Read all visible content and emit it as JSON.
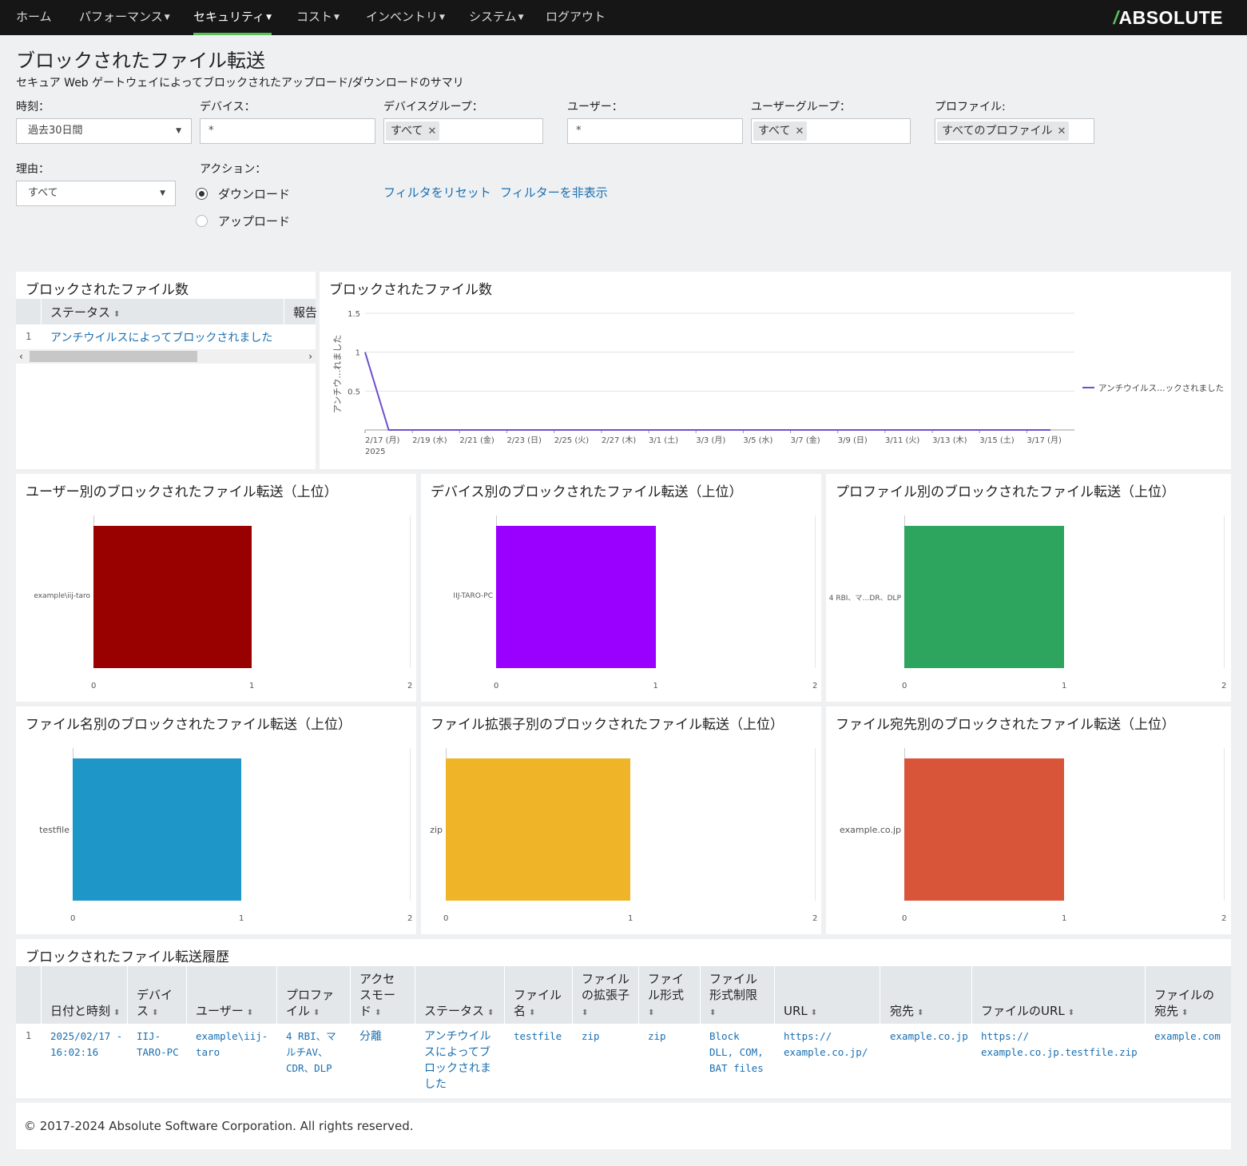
{
  "nav": {
    "home": "ホーム",
    "performance": "パフォーマンス",
    "security": "セキュリティ",
    "cost": "コスト",
    "inventory": "インベントリ",
    "system": "システム",
    "logout": "ログアウト",
    "brand": "ABSOLUTE",
    "brand_mark": "/"
  },
  "page": {
    "title": "ブロックされたファイル転送",
    "subtitle": "セキュア Web ゲートウェイによってブロックされたアップロード/ダウンロードのサマリ"
  },
  "filters": {
    "time_label": "時刻：",
    "time_value": "過去30日間",
    "device_label": "デバイス：",
    "device_value": "*",
    "device_group_label": "デバイスグループ：",
    "device_group_tag": "すべて",
    "user_label": "ユーザー：",
    "user_value": "*",
    "user_group_label": "ユーザーグループ：",
    "user_group_tag": "すべて",
    "profile_label": "プロファイル:",
    "profile_tag": "すべてのプロファイル",
    "reason_label": "理由：",
    "reason_value": "すべて",
    "action_label": "アクション：",
    "action_download": "ダウンロード",
    "action_upload": "アップロード",
    "selected_action": "ダウンロード",
    "reset_link": "フィルタをリセット",
    "hide_link": "フィルターを非表示"
  },
  "count_table": {
    "title": "ブロックされたファイル数",
    "col_status": "ステータス",
    "col_report": "報告",
    "rows": [
      {
        "index": "1",
        "status": "アンチウイルスによってブロックされました"
      }
    ]
  },
  "line_chart": {
    "title": "ブロックされたファイル数",
    "ylabel": "アンチウ…れました",
    "year_label": "2025",
    "line_color": "#6f4fd0"
  },
  "bar_panels": {
    "user": {
      "title": "ユーザー別のブロックされたファイル転送（上位）",
      "color": "#990000"
    },
    "device": {
      "title": "デバイス別のブロックされたファイル転送（上位）",
      "color": "#9900ff"
    },
    "profile": {
      "title": "プロファイル別のブロックされたファイル転送（上位）",
      "color": "#2ea55e"
    },
    "filename": {
      "title": "ファイル名別のブロックされたファイル転送（上位）",
      "color": "#1e96c8"
    },
    "ext": {
      "title": "ファイル拡張子別のブロックされたファイル転送（上位）",
      "color": "#f0b429"
    },
    "dest": {
      "title": "ファイル宛先別のブロックされたファイル転送（上位）",
      "color": "#d9553a"
    }
  },
  "chart_data": [
    {
      "type": "line",
      "title": "ブロックされたファイル数",
      "ylabel": "アンチウ…れました",
      "x": [
        "2/17 (月)",
        "2/18",
        "2/19 (水)",
        "2/20",
        "2/21 (金)",
        "2/22",
        "2/23 (日)",
        "2/24",
        "2/25 (火)",
        "2/26",
        "2/27 (木)",
        "2/28",
        "3/1 (土)",
        "3/2",
        "3/3 (月)",
        "3/4",
        "3/5 (水)",
        "3/6",
        "3/7 (金)",
        "3/8",
        "3/9 (日)",
        "3/10",
        "3/11 (火)",
        "3/12",
        "3/13 (木)",
        "3/14",
        "3/15 (土)",
        "3/16",
        "3/17 (月)",
        "3/18"
      ],
      "x_tick_labels": [
        "2/17 (月)",
        "2/19 (水)",
        "2/21 (金)",
        "2/23 (日)",
        "2/25 (火)",
        "2/27 (木)",
        "3/1 (土)",
        "3/3 (月)",
        "3/5 (水)",
        "3/7 (金)",
        "3/9 (日)",
        "3/11 (火)",
        "3/13 (木)",
        "3/15 (土)",
        "3/17 (月)"
      ],
      "y_tick_labels": [
        "1.5",
        "1",
        "0.5"
      ],
      "ylim": [
        0,
        1.5
      ],
      "legend_position": "right",
      "series": [
        {
          "name": "アンチウイルス…ックされました",
          "values": [
            1,
            0,
            0,
            0,
            0,
            0,
            0,
            0,
            0,
            0,
            0,
            0,
            0,
            0,
            0,
            0,
            0,
            0,
            0,
            0,
            0,
            0,
            0,
            0,
            0,
            0,
            0,
            0,
            0,
            0
          ]
        }
      ],
      "grid": true
    },
    {
      "type": "bar",
      "orientation": "horizontal",
      "title": "ユーザー別のブロックされたファイル転送（上位）",
      "categories": [
        "example\\iij-taro"
      ],
      "values": [
        1
      ],
      "xlim": [
        0,
        2
      ],
      "x_tick_labels": [
        "0",
        "1",
        "2"
      ]
    },
    {
      "type": "bar",
      "orientation": "horizontal",
      "title": "デバイス別のブロックされたファイル転送（上位）",
      "categories": [
        "IIJ-TARO-PC"
      ],
      "values": [
        1
      ],
      "xlim": [
        0,
        2
      ],
      "x_tick_labels": [
        "0",
        "1",
        "2"
      ]
    },
    {
      "type": "bar",
      "orientation": "horizontal",
      "title": "プロファイル別のブロックされたファイル転送（上位）",
      "categories": [
        "4 RBI、マ…DR、DLP"
      ],
      "values": [
        1
      ],
      "xlim": [
        0,
        2
      ],
      "x_tick_labels": [
        "0",
        "1",
        "2"
      ]
    },
    {
      "type": "bar",
      "orientation": "horizontal",
      "title": "ファイル名別のブロックされたファイル転送（上位）",
      "categories": [
        "testfile"
      ],
      "values": [
        1
      ],
      "xlim": [
        0,
        2
      ],
      "x_tick_labels": [
        "0",
        "1",
        "2"
      ]
    },
    {
      "type": "bar",
      "orientation": "horizontal",
      "title": "ファイル拡張子別のブロックされたファイル転送（上位）",
      "categories": [
        "zip"
      ],
      "values": [
        1
      ],
      "xlim": [
        0,
        2
      ],
      "x_tick_labels": [
        "0",
        "1",
        "2"
      ]
    },
    {
      "type": "bar",
      "orientation": "horizontal",
      "title": "ファイル宛先別のブロックされたファイル転送（上位）",
      "categories": [
        "example.co.jp"
      ],
      "values": [
        1
      ],
      "xlim": [
        0,
        2
      ],
      "x_tick_labels": [
        "0",
        "1",
        "2"
      ]
    }
  ],
  "history": {
    "title": "ブロックされたファイル転送履歴",
    "columns": [
      {
        "l1": "",
        "l2": "日付と時刻"
      },
      {
        "l1": "デバイ",
        "l2": "ス"
      },
      {
        "l1": "",
        "l2": "ユーザー"
      },
      {
        "l1": "プロファ",
        "l2": "イル"
      },
      {
        "l0": "アクセ",
        "l1": "スモー",
        "l2": "ド"
      },
      {
        "l1": "",
        "l2": "ステータス"
      },
      {
        "l1": "ファイル",
        "l2": "名"
      },
      {
        "l1": "ファイル",
        "l1b": "の拡張子",
        "l2": ""
      },
      {
        "l1": "ファイ",
        "l1b": "ル形式",
        "l2": ""
      },
      {
        "l1": "ファイル",
        "l1b": "形式制限",
        "l2": ""
      },
      {
        "l1": "",
        "l2": "URL"
      },
      {
        "l1": "",
        "l2": "宛先"
      },
      {
        "l1": "",
        "l2": "ファイルのURL"
      },
      {
        "l1": "ファイルの",
        "l2": "宛先"
      }
    ],
    "row": {
      "index": "1",
      "datetime_1": "2025/02/17 -",
      "datetime_2": "16:02:16",
      "device_1": "IIJ-",
      "device_2": "TARO-PC",
      "user_1": "example\\iij-",
      "user_2": "taro",
      "profile_1": "4 RBI、マ",
      "profile_2": "ルチAV、",
      "profile_3": "CDR、DLP",
      "access_mode": "分離",
      "status_1": "アンチウイル",
      "status_2": "スによってブ",
      "status_3": "ロックされま",
      "status_4": "した",
      "filename": "testfile",
      "extension": "zip",
      "format": "zip",
      "restriction_1": "Block",
      "restriction_2": "DLL, COM,",
      "restriction_3": "BAT files",
      "url_1": "https://",
      "url_2": "example.co.jp/",
      "dest": "example.co.jp",
      "file_url_1": "https://",
      "file_url_2": "example.co.jp.testfile.zip",
      "file_dest": "example.com"
    }
  },
  "footer": {
    "copyright": "© 2017-2024 Absolute Software Corporation. All rights reserved."
  }
}
